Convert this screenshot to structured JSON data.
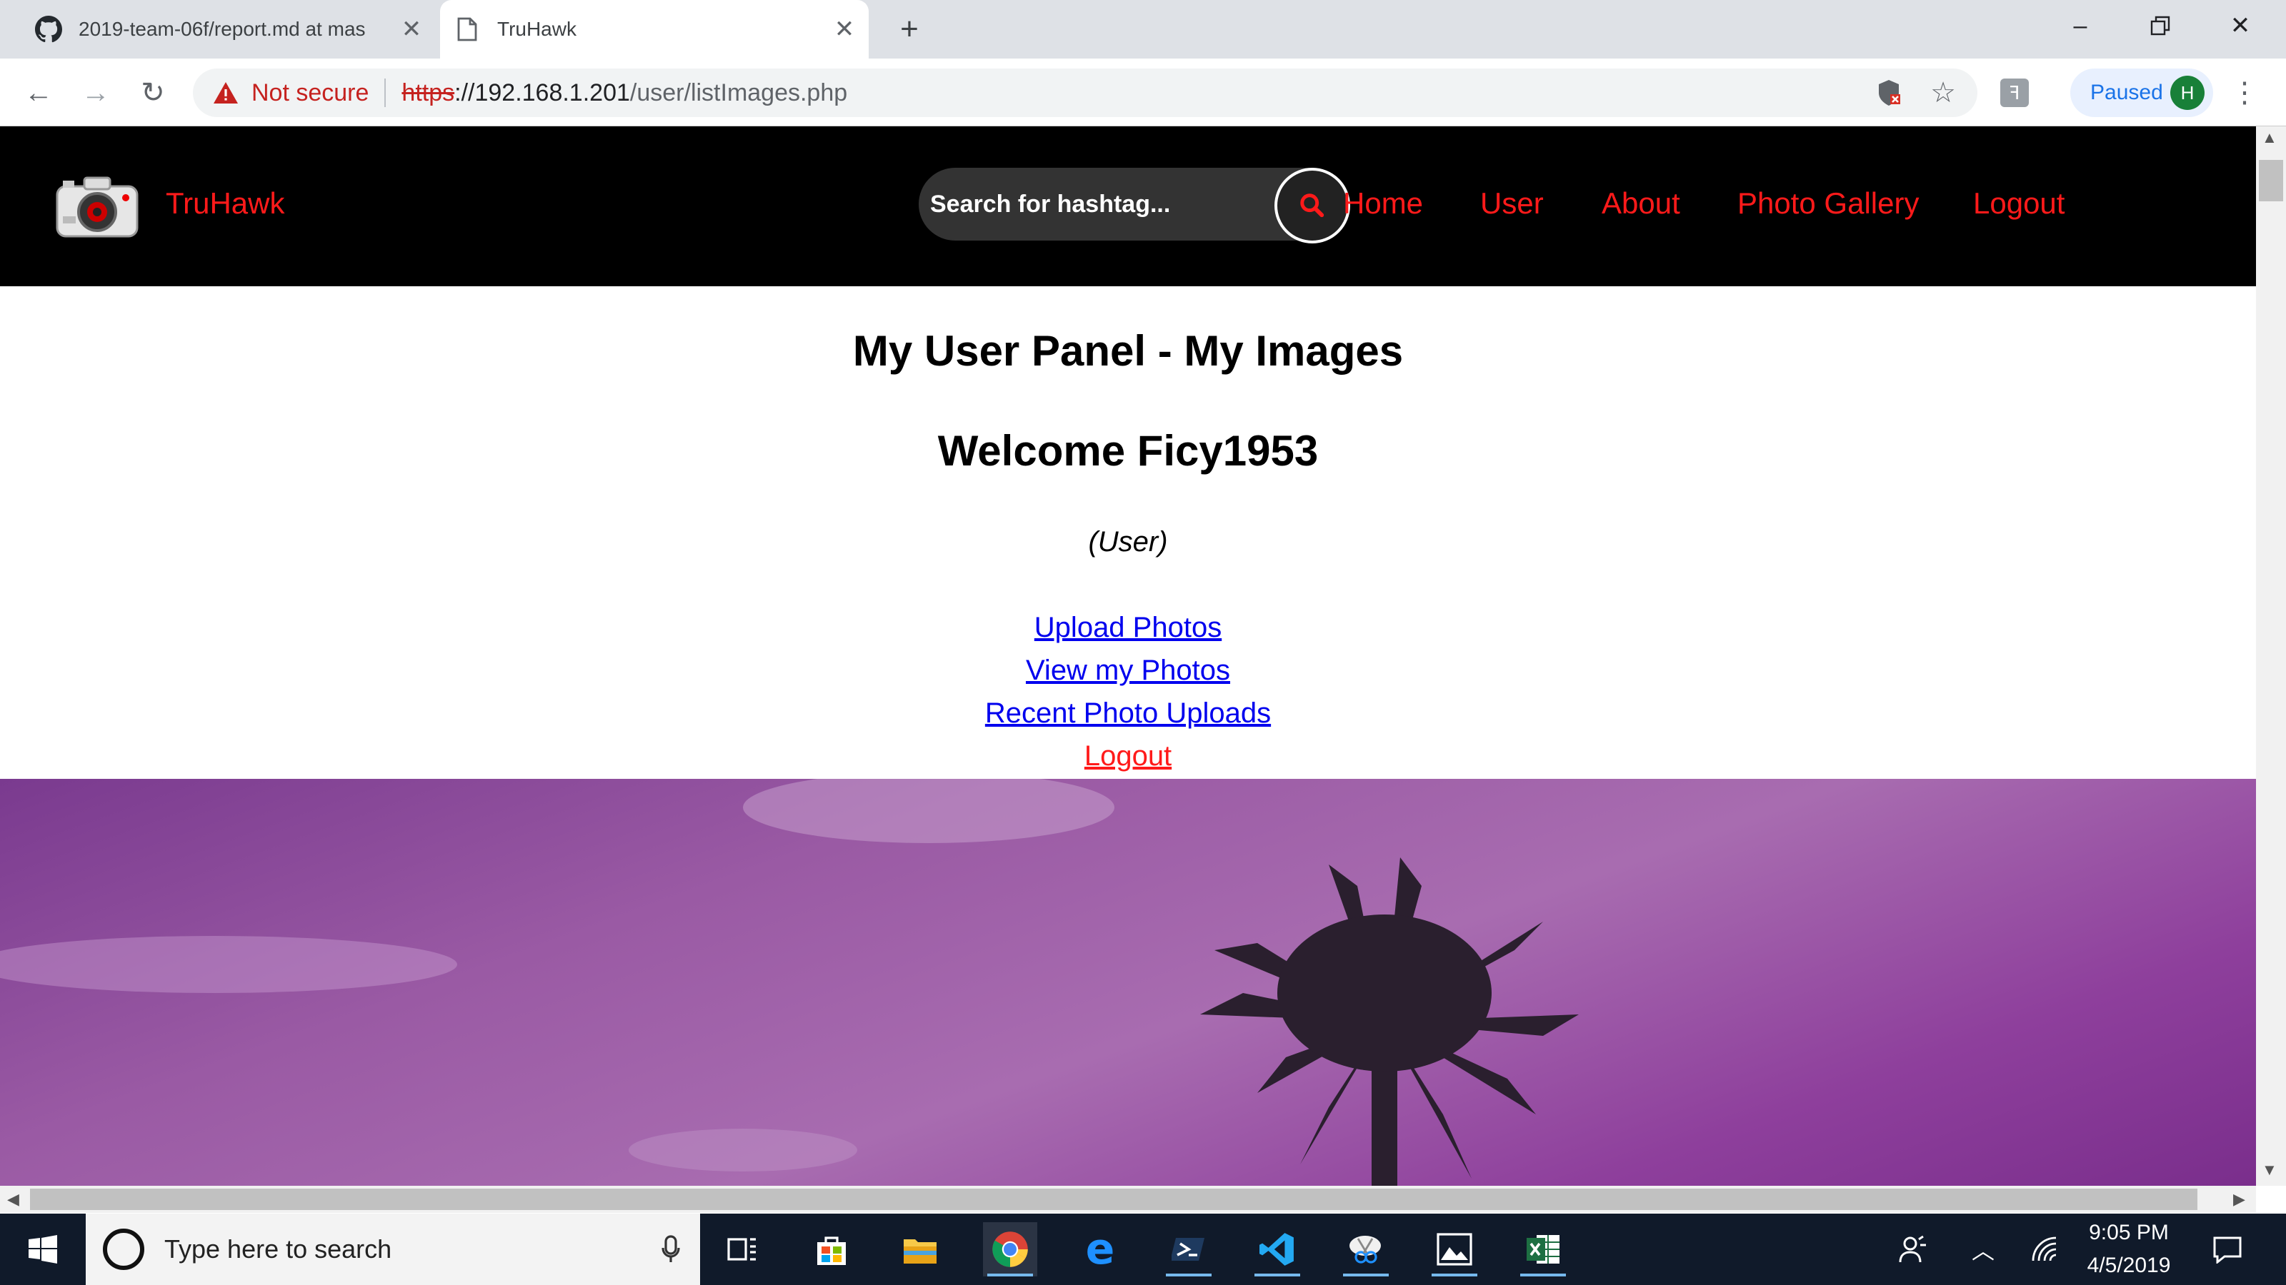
{
  "browser": {
    "tabs": [
      {
        "title": "2019-team-06f/report.md at mas",
        "active": false
      },
      {
        "title": "TruHawk",
        "active": true
      }
    ],
    "address": {
      "security": "Not secure",
      "scheme": "https",
      "host": "://192.168.1.201",
      "path": "/user/listImages.php"
    },
    "profile": {
      "status": "Paused",
      "avatar_letter": "H"
    }
  },
  "site": {
    "brand": "TruHawk",
    "search_placeholder": "Search for hashtag...",
    "nav": [
      "Home",
      "User",
      "About",
      "Photo Gallery",
      "Logout"
    ],
    "panel_title": "My User Panel - My Images",
    "welcome": "Welcome Ficy1953",
    "role": "(User)",
    "links": [
      "Upload Photos",
      "View my Photos",
      "Recent Photo Uploads",
      "Logout"
    ],
    "colors": {
      "accent": "#ff1a1a",
      "link": "#0000ee",
      "nav_bg": "#000000"
    }
  },
  "taskbar": {
    "search_placeholder": "Type here to search",
    "time": "9:05 PM",
    "date": "4/5/2019"
  }
}
